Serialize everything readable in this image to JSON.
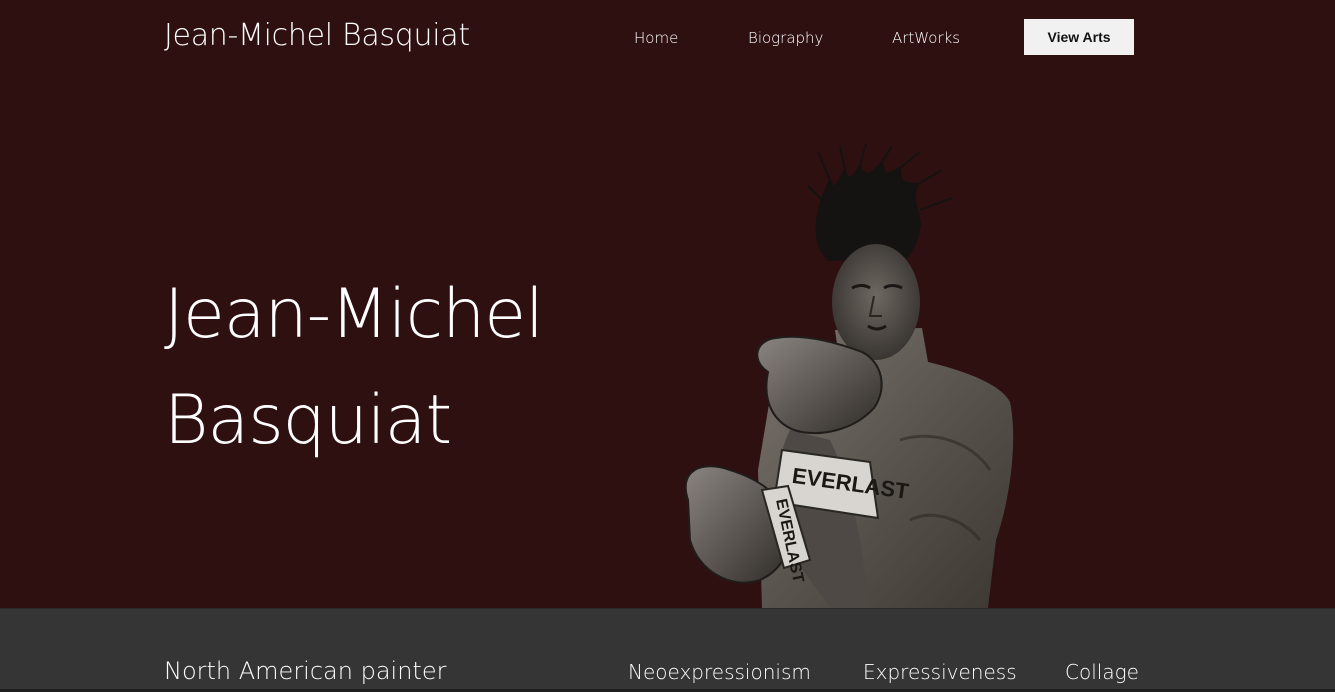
{
  "header": {
    "site_title": "Jean-Michel Basquiat",
    "nav": [
      {
        "label": "Home"
      },
      {
        "label": "Biography"
      },
      {
        "label": "ArtWorks"
      }
    ],
    "cta_label": "View Arts"
  },
  "hero": {
    "heading_line1": "Jean-Michel",
    "heading_line2": "Basquiat",
    "image": {
      "icon": "boxer-portrait-image",
      "glove_text": "EVERLAST",
      "glove_text_lower": "EVERLAST"
    }
  },
  "info_bar": {
    "label": "North American painter",
    "tags": [
      {
        "label": "Neoexpressionism"
      },
      {
        "label": "Expressiveness"
      },
      {
        "label": "Collage"
      }
    ]
  },
  "colors": {
    "hero_background": "#2e1010",
    "info_bar_background": "#353535",
    "text": "#ffffff",
    "button_background": "#f1f1f1",
    "button_text": "#111111"
  }
}
